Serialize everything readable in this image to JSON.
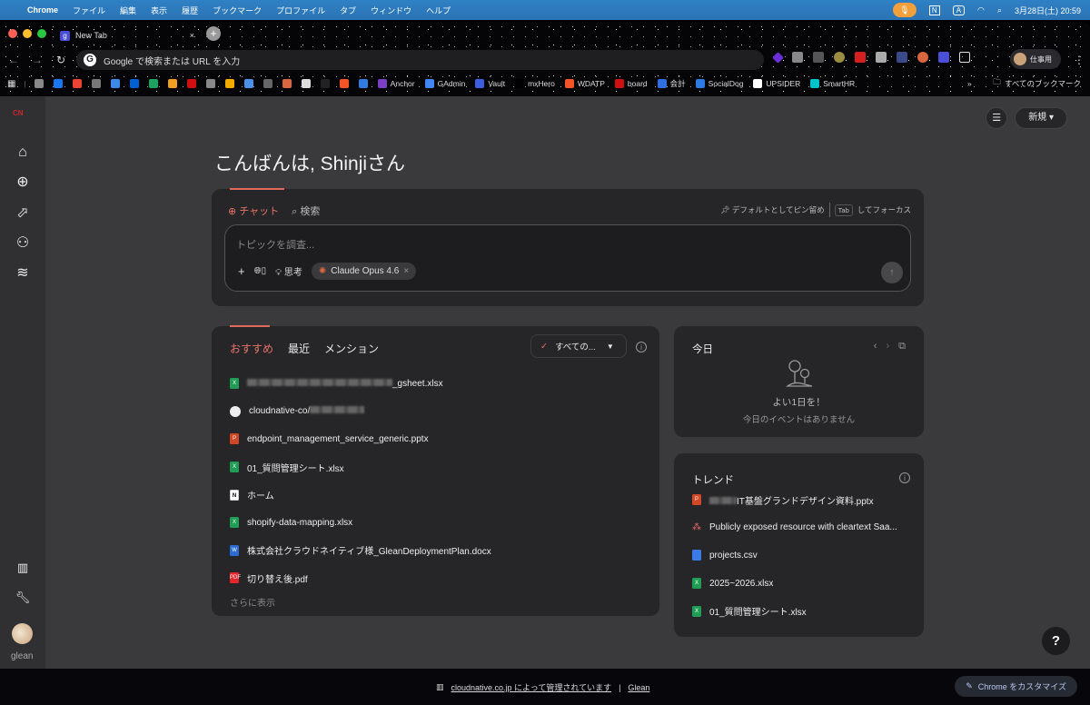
{
  "menubar": {
    "app": "Chrome",
    "items": [
      "ファイル",
      "編集",
      "表示",
      "履歴",
      "ブックマーク",
      "プロファイル",
      "タブ",
      "ウィンドウ",
      "ヘルプ"
    ],
    "clock": "3月28日(土) 20:59",
    "input_mode": "A"
  },
  "browser": {
    "tab_title": "New Tab",
    "tab_favicon": "g",
    "omnibox_placeholder": "Google で検索または URL を入力",
    "profile_label": "仕事用",
    "bookmarks": [
      {
        "label": "",
        "color": "#888"
      },
      {
        "label": "",
        "color": "#1877f2"
      },
      {
        "label": "",
        "color": "#ea4335"
      },
      {
        "label": "",
        "color": "#777"
      },
      {
        "label": "",
        "color": "#3b8be6"
      },
      {
        "label": "",
        "color": "#0061d5"
      },
      {
        "label": "",
        "color": "#1ea362"
      },
      {
        "label": "",
        "color": "#f0a020"
      },
      {
        "label": "",
        "color": "#d01010"
      },
      {
        "label": "",
        "color": "#888"
      },
      {
        "label": "",
        "color": "#f2a900"
      },
      {
        "label": "",
        "color": "#4a8fe8"
      },
      {
        "label": "",
        "color": "#666"
      },
      {
        "label": "",
        "color": "#d9663e"
      },
      {
        "label": "",
        "color": "#ddd"
      },
      {
        "label": "",
        "color": "#222"
      },
      {
        "label": "",
        "color": "#f35325"
      },
      {
        "label": "",
        "color": "#2e7be6"
      },
      {
        "label": "Anchor",
        "color": "#7b3fc4"
      },
      {
        "label": "GAdmin",
        "color": "#4285f4"
      },
      {
        "label": "Vault",
        "color": "#3a5fe0"
      },
      {
        "label": "mxHero",
        "color": "#000"
      },
      {
        "label": "WDATP",
        "color": "#f35325"
      },
      {
        "label": "board",
        "color": "#d01010"
      },
      {
        "label": "会計",
        "color": "#2f6fe0"
      },
      {
        "label": "SocialDog",
        "color": "#2c7be5"
      },
      {
        "label": "UPSIDER",
        "color": "#fff"
      },
      {
        "label": "SmartHR",
        "color": "#00c4cc"
      }
    ],
    "all_bookmarks": "すべてのブックマーク",
    "overflow": "»"
  },
  "page": {
    "greeting": "こんばんは, Shinjiさん",
    "new_button": "新規",
    "chat": {
      "tab_chat": "チャット",
      "tab_search": "検索",
      "pin_default": "デフォルトとしてピン留め",
      "tab_key": "Tab",
      "focus_hint": "してフォーカス",
      "placeholder": "トピックを調査...",
      "think": "思考",
      "model": "Claude Opus 4.6"
    },
    "recommend": {
      "tabs": [
        "おすすめ",
        "最近",
        "メンション"
      ],
      "filter": "すべての...",
      "more": "さらに表示",
      "items": [
        {
          "name": "_gsheet.xlsx",
          "type": "xlsx",
          "redacted": true
        },
        {
          "name": "cloudnative-co/",
          "type": "github",
          "redacted_after": true
        },
        {
          "name": "endpoint_management_service_generic.pptx",
          "type": "pptx"
        },
        {
          "name": "01_質問管理シート.xlsx",
          "type": "xlsx"
        },
        {
          "name": "ホーム",
          "type": "notion"
        },
        {
          "name": "shopify-data-mapping.xlsx",
          "type": "xlsx"
        },
        {
          "name": "株式会社クラウドネイティブ様_GleanDeploymentPlan.docx",
          "type": "docx"
        },
        {
          "name": "切り替え後.pdf",
          "type": "pdf"
        }
      ]
    },
    "today": {
      "title": "今日",
      "good_day": "よい1日を！",
      "no_events": "今日のイベントはありません"
    },
    "trend": {
      "title": "トレンド",
      "items": [
        {
          "name": "IT基盤グランドデザイン資料.pptx",
          "type": "pptx",
          "redacted": true
        },
        {
          "name": "Publicly exposed resource with cleartext Saa...",
          "type": "asana"
        },
        {
          "name": "projects.csv",
          "type": "csv"
        },
        {
          "name": "2025~2026.xlsx",
          "type": "xlsx"
        },
        {
          "name": "01_質問管理シート.xlsx",
          "type": "xlsx"
        }
      ]
    },
    "help": "?",
    "sidebar_brand": "glean"
  },
  "footer": {
    "managed": "cloudnative.co.jp によって管理されています",
    "sep": "|",
    "glean": "Glean",
    "customize": "Chrome をカスタマイズ"
  },
  "colors": {
    "accent": "#e8736a",
    "xlsx": "#1f9d55",
    "pptx": "#d24726",
    "docx": "#2b6bd6",
    "pdf": "#e5252a",
    "csv": "#3b7be8",
    "asana": "#f06a6a"
  }
}
